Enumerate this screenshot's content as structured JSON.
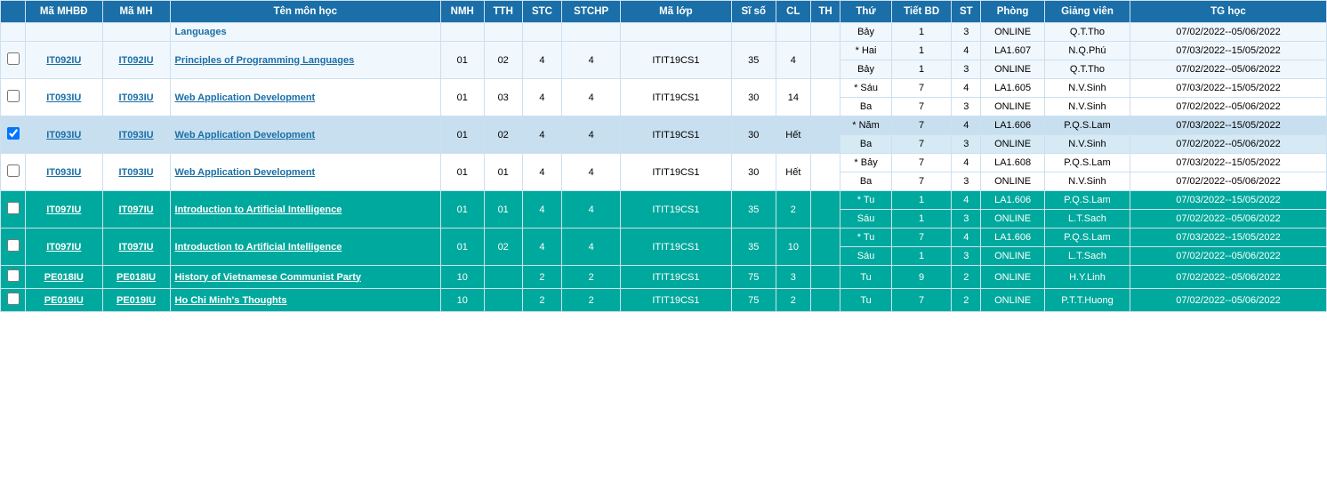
{
  "table": {
    "headers": [
      {
        "id": "mhbd",
        "label": "Mã MHBĐ"
      },
      {
        "id": "mh",
        "label": "Mã MH"
      },
      {
        "id": "ten",
        "label": "Tên môn học"
      },
      {
        "id": "nmh",
        "label": "NMH"
      },
      {
        "id": "tth",
        "label": "TTH"
      },
      {
        "id": "stc",
        "label": "STC"
      },
      {
        "id": "stchp",
        "label": "STCHP"
      },
      {
        "id": "malop",
        "label": "Mã lớp"
      },
      {
        "id": "siso",
        "label": "Sĩ số"
      },
      {
        "id": "cl",
        "label": "CL"
      },
      {
        "id": "th",
        "label": "TH"
      },
      {
        "id": "thu",
        "label": "Thứ"
      },
      {
        "id": "tietbd",
        "label": "Tiết BD"
      },
      {
        "id": "st",
        "label": "ST"
      },
      {
        "id": "phong",
        "label": "Phòng"
      },
      {
        "id": "giangvien",
        "label": "Giảng viên"
      },
      {
        "id": "tghoc",
        "label": "TG học"
      }
    ],
    "rows": [
      {
        "id": "row-top-partial",
        "checkbox": false,
        "mhbd": "",
        "mh": "",
        "ten": "Languages",
        "nmh": "",
        "tth": "",
        "stc": "",
        "stchp": "",
        "malop": "",
        "siso": "",
        "cl": "",
        "th": "",
        "sub": [
          {
            "star": false,
            "thu": "Bảy",
            "tietbd": "1",
            "st": "3",
            "phong": "ONLINE",
            "giangvien": "Q.T.Tho",
            "tghoc": "07/02/2022--05/06/2022"
          }
        ],
        "type": "partial"
      },
      {
        "id": "row-it092iu",
        "checkbox": false,
        "mhbd": "IT092IU",
        "mh": "IT092IU",
        "ten": "Principles of Programming Languages",
        "nmh": "01",
        "tth": "02",
        "stc": "4",
        "stchp": "4",
        "malop": "ITIT19CS1",
        "siso": "35",
        "cl": "4",
        "th": "",
        "sub": [
          {
            "star": true,
            "thu": "Hai",
            "tietbd": "1",
            "st": "4",
            "phong": "LA1.607",
            "giangvien": "N.Q.Phú",
            "tghoc": "07/03/2022--15/05/2022"
          },
          {
            "star": false,
            "thu": "Bảy",
            "tietbd": "1",
            "st": "3",
            "phong": "ONLINE",
            "giangvien": "Q.T.Tho",
            "tghoc": "07/02/2022--05/06/2022"
          }
        ],
        "type": "normal"
      },
      {
        "id": "row-it093iu-a",
        "checkbox": false,
        "mhbd": "IT093IU",
        "mh": "IT093IU",
        "ten": "Web Application Development",
        "nmh": "01",
        "tth": "03",
        "stc": "4",
        "stchp": "4",
        "malop": "ITIT19CS1",
        "siso": "30",
        "cl": "14",
        "th": "",
        "sub": [
          {
            "star": true,
            "thu": "Sáu",
            "tietbd": "7",
            "st": "4",
            "phong": "LA1.605",
            "giangvien": "N.V.Sinh",
            "tghoc": "07/03/2022--15/05/2022"
          },
          {
            "star": false,
            "thu": "Ba",
            "tietbd": "7",
            "st": "3",
            "phong": "ONLINE",
            "giangvien": "N.V.Sinh",
            "tghoc": "07/02/2022--05/06/2022"
          }
        ],
        "type": "normal"
      },
      {
        "id": "row-it093iu-b",
        "checkbox": true,
        "mhbd": "IT093IU",
        "mh": "IT093IU",
        "ten": "Web Application Development",
        "nmh": "01",
        "tth": "02",
        "stc": "4",
        "stchp": "4",
        "malop": "ITIT19CS1",
        "siso": "30",
        "cl": "Hết",
        "th": "",
        "sub": [
          {
            "star": true,
            "thu": "Năm",
            "tietbd": "7",
            "st": "4",
            "phong": "LA1.606",
            "giangvien": "P.Q.S.Lam",
            "tghoc": "07/03/2022--15/05/2022"
          },
          {
            "star": false,
            "thu": "Ba",
            "tietbd": "7",
            "st": "3",
            "phong": "ONLINE",
            "giangvien": "N.V.Sinh",
            "tghoc": "07/02/2022--05/06/2022"
          }
        ],
        "type": "checked"
      },
      {
        "id": "row-it093iu-c",
        "checkbox": false,
        "mhbd": "IT093IU",
        "mh": "IT093IU",
        "ten": "Web Application Development",
        "nmh": "01",
        "tth": "01",
        "stc": "4",
        "stchp": "4",
        "malop": "ITIT19CS1",
        "siso": "30",
        "cl": "Hết",
        "th": "",
        "sub": [
          {
            "star": true,
            "thu": "Bảy",
            "tietbd": "7",
            "st": "4",
            "phong": "LA1.608",
            "giangvien": "P.Q.S.Lam",
            "tghoc": "07/03/2022--15/05/2022"
          },
          {
            "star": false,
            "thu": "Ba",
            "tietbd": "7",
            "st": "3",
            "phong": "ONLINE",
            "giangvien": "N.V.Sinh",
            "tghoc": "07/02/2022--05/06/2022"
          }
        ],
        "type": "normal"
      },
      {
        "id": "row-it097iu-a",
        "checkbox": false,
        "mhbd": "IT097IU",
        "mh": "IT097IU",
        "ten": "Introduction to Artificial Intelligence",
        "nmh": "01",
        "tth": "01",
        "stc": "4",
        "stchp": "4",
        "malop": "ITIT19CS1",
        "siso": "35",
        "cl": "2",
        "th": "",
        "sub": [
          {
            "star": true,
            "thu": "Tu",
            "tietbd": "1",
            "st": "4",
            "phong": "LA1.606",
            "giangvien": "P.Q.S.Lam",
            "tghoc": "07/03/2022--15/05/2022"
          },
          {
            "star": false,
            "thu": "Sáu",
            "tietbd": "1",
            "st": "3",
            "phong": "ONLINE",
            "giangvien": "L.T.Sach",
            "tghoc": "07/02/2022--05/06/2022"
          }
        ],
        "type": "teal"
      },
      {
        "id": "row-it097iu-b",
        "checkbox": false,
        "mhbd": "IT097IU",
        "mh": "IT097IU",
        "ten": "Introduction to Artificial Intelligence",
        "nmh": "01",
        "tth": "02",
        "stc": "4",
        "stchp": "4",
        "malop": "ITIT19CS1",
        "siso": "35",
        "cl": "10",
        "th": "",
        "sub": [
          {
            "star": true,
            "thu": "Tu",
            "tietbd": "7",
            "st": "4",
            "phong": "LA1.606",
            "giangvien": "P.Q.S.Lam",
            "tghoc": "07/03/2022--15/05/2022"
          },
          {
            "star": false,
            "thu": "Sáu",
            "tietbd": "1",
            "st": "3",
            "phong": "ONLINE",
            "giangvien": "L.T.Sach",
            "tghoc": "07/02/2022--05/06/2022"
          }
        ],
        "type": "teal"
      },
      {
        "id": "row-pe018iu",
        "checkbox": false,
        "mhbd": "PE018IU",
        "mh": "PE018IU",
        "ten": "History of Vietnamese Communist Party",
        "nmh": "10",
        "tth": "",
        "stc": "2",
        "stchp": "2",
        "malop": "ITIT19CS1",
        "siso": "75",
        "cl": "3",
        "th": "",
        "sub": [
          {
            "star": false,
            "thu": "Tu",
            "tietbd": "9",
            "st": "2",
            "phong": "ONLINE",
            "giangvien": "H.Y.Linh",
            "tghoc": "07/02/2022--05/06/2022"
          }
        ],
        "type": "teal"
      },
      {
        "id": "row-pe019iu",
        "checkbox": false,
        "mhbd": "PE019IU",
        "mh": "PE019IU",
        "ten": "Ho Chi Minh's Thoughts",
        "nmh": "10",
        "tth": "",
        "stc": "2",
        "stchp": "2",
        "malop": "ITIT19CS1",
        "siso": "75",
        "cl": "2",
        "th": "",
        "sub": [
          {
            "star": false,
            "thu": "Tu",
            "tietbd": "7",
            "st": "2",
            "phong": "ONLINE",
            "giangvien": "P.T.T.Huong",
            "tghoc": "07/02/2022--05/06/2022"
          }
        ],
        "type": "teal"
      }
    ]
  }
}
